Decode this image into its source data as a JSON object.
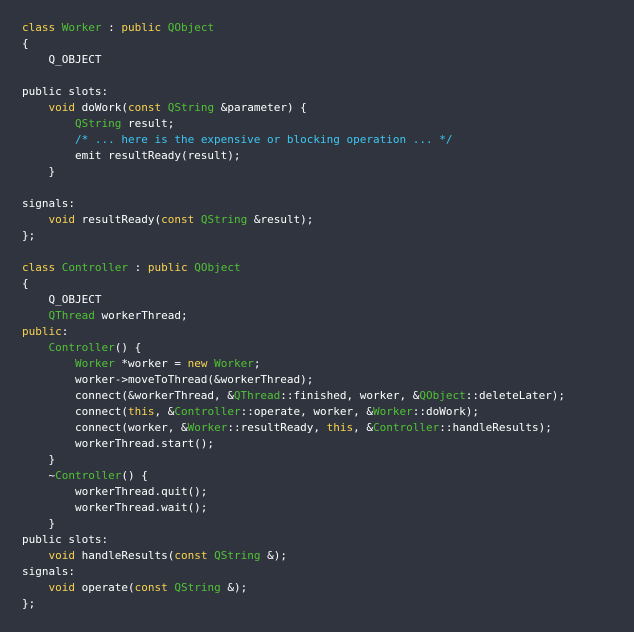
{
  "colors": {
    "background": "#2f343f",
    "plain_text": "#ffffff",
    "keyword": "#f8d34f",
    "type": "#52c234",
    "comment": "#3ec7f2"
  },
  "code": {
    "language": "C++",
    "lines": [
      [
        [
          "kw",
          "class"
        ],
        [
          "p",
          " "
        ],
        [
          "t",
          "Worker"
        ],
        [
          "p",
          " : "
        ],
        [
          "kw",
          "public"
        ],
        [
          "p",
          " "
        ],
        [
          "t",
          "QObject"
        ]
      ],
      [
        [
          "p",
          "{"
        ]
      ],
      [
        [
          "p",
          "    Q_OBJECT"
        ]
      ],
      [],
      [
        [
          "p",
          "public slots:"
        ]
      ],
      [
        [
          "p",
          "    "
        ],
        [
          "kw",
          "void"
        ],
        [
          "p",
          " doWork("
        ],
        [
          "kw",
          "const"
        ],
        [
          "p",
          " "
        ],
        [
          "t",
          "QString"
        ],
        [
          "p",
          " &parameter) {"
        ]
      ],
      [
        [
          "p",
          "        "
        ],
        [
          "t",
          "QString"
        ],
        [
          "p",
          " result;"
        ]
      ],
      [
        [
          "p",
          "        "
        ],
        [
          "c",
          "/* ... here is the expensive or blocking operation ... */"
        ]
      ],
      [
        [
          "p",
          "        emit resultReady(result);"
        ]
      ],
      [
        [
          "p",
          "    }"
        ]
      ],
      [],
      [
        [
          "p",
          "signals:"
        ]
      ],
      [
        [
          "p",
          "    "
        ],
        [
          "kw",
          "void"
        ],
        [
          "p",
          " resultReady("
        ],
        [
          "kw",
          "const"
        ],
        [
          "p",
          " "
        ],
        [
          "t",
          "QString"
        ],
        [
          "p",
          " &result);"
        ]
      ],
      [
        [
          "p",
          "};"
        ]
      ],
      [],
      [
        [
          "kw",
          "class"
        ],
        [
          "p",
          " "
        ],
        [
          "t",
          "Controller"
        ],
        [
          "p",
          " : "
        ],
        [
          "kw",
          "public"
        ],
        [
          "p",
          " "
        ],
        [
          "t",
          "QObject"
        ]
      ],
      [
        [
          "p",
          "{"
        ]
      ],
      [
        [
          "p",
          "    Q_OBJECT"
        ]
      ],
      [
        [
          "p",
          "    "
        ],
        [
          "t",
          "QThread"
        ],
        [
          "p",
          " workerThread;"
        ]
      ],
      [
        [
          "kw",
          "public"
        ],
        [
          "p",
          ":"
        ]
      ],
      [
        [
          "p",
          "    "
        ],
        [
          "t",
          "Controller"
        ],
        [
          "p",
          "() {"
        ]
      ],
      [
        [
          "p",
          "        "
        ],
        [
          "t",
          "Worker"
        ],
        [
          "p",
          " *worker = "
        ],
        [
          "kw",
          "new"
        ],
        [
          "p",
          " "
        ],
        [
          "t",
          "Worker"
        ],
        [
          "p",
          ";"
        ]
      ],
      [
        [
          "p",
          "        worker->moveToThread(&workerThread);"
        ]
      ],
      [
        [
          "p",
          "        connect(&workerThread, &"
        ],
        [
          "t",
          "QThread"
        ],
        [
          "p",
          "::finished, worker, &"
        ],
        [
          "t",
          "QObject"
        ],
        [
          "p",
          "::deleteLater);"
        ]
      ],
      [
        [
          "p",
          "        connect("
        ],
        [
          "kw",
          "this"
        ],
        [
          "p",
          ", &"
        ],
        [
          "t",
          "Controller"
        ],
        [
          "p",
          "::operate, worker, &"
        ],
        [
          "t",
          "Worker"
        ],
        [
          "p",
          "::doWork);"
        ]
      ],
      [
        [
          "p",
          "        connect(worker, &"
        ],
        [
          "t",
          "Worker"
        ],
        [
          "p",
          "::resultReady, "
        ],
        [
          "kw",
          "this"
        ],
        [
          "p",
          ", &"
        ],
        [
          "t",
          "Controller"
        ],
        [
          "p",
          "::handleResults);"
        ]
      ],
      [
        [
          "p",
          "        workerThread.start();"
        ]
      ],
      [
        [
          "p",
          "    }"
        ]
      ],
      [
        [
          "p",
          "    ~"
        ],
        [
          "t",
          "Controller"
        ],
        [
          "p",
          "() {"
        ]
      ],
      [
        [
          "p",
          "        workerThread.quit();"
        ]
      ],
      [
        [
          "p",
          "        workerThread.wait();"
        ]
      ],
      [
        [
          "p",
          "    }"
        ]
      ],
      [
        [
          "p",
          "public slots:"
        ]
      ],
      [
        [
          "p",
          "    "
        ],
        [
          "kw",
          "void"
        ],
        [
          "p",
          " handleResults("
        ],
        [
          "kw",
          "const"
        ],
        [
          "p",
          " "
        ],
        [
          "t",
          "QString"
        ],
        [
          "p",
          " &);"
        ]
      ],
      [
        [
          "p",
          "signals:"
        ]
      ],
      [
        [
          "p",
          "    "
        ],
        [
          "kw",
          "void"
        ],
        [
          "p",
          " operate("
        ],
        [
          "kw",
          "const"
        ],
        [
          "p",
          " "
        ],
        [
          "t",
          "QString"
        ],
        [
          "p",
          " &);"
        ]
      ],
      [
        [
          "p",
          "};"
        ]
      ]
    ]
  }
}
